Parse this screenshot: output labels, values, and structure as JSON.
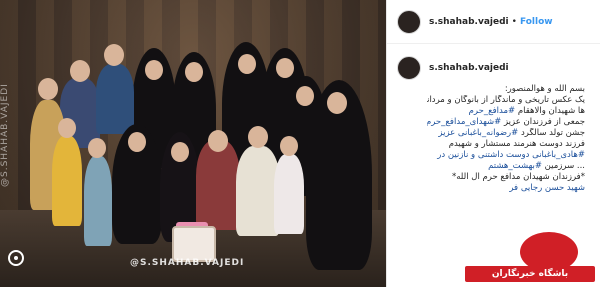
{
  "photo": {
    "side_watermark": "@S.SHAHAB.VAJEDI",
    "bottom_watermark": "@S.SHAHAB.VAJEDI"
  },
  "post": {
    "username": "s.shahab.vajedi",
    "dot": "•",
    "follow_label": "Follow",
    "comment_username": "s.shahab.vajedi",
    "caption_lines": [
      {
        "text": "بسم الله و هوالمنصور:",
        "hashtag": ""
      },
      {
        "text": "یک عکس تاریخی و ماندگار از بانوگان و مردانه",
        "hashtag": ""
      },
      {
        "text": "ها شهیدان والاهقام ",
        "hashtag": "#مدافع_حرم"
      },
      {
        "text": "جمعی از فرزندان عزیز ",
        "hashtag": "#شهدای_مدافع_حرم در"
      },
      {
        "text": "جشن تولد سالگرد ",
        "hashtag": "#رضوانه_باغبانی عزیز"
      },
      {
        "text": "فرزند دوست هنرمند مستشار و شهیدم",
        "hashtag": ""
      },
      {
        "text": "",
        "hashtag": "#هادی_باغبانی دوست داشتنی و نازنین در"
      },
      {
        "text": "... سرزمین ",
        "hashtag": "#بهشت_هشتم"
      },
      {
        "text": "*فرزندان شهیدان مدافع حرم آل الله*",
        "hashtag": ""
      },
      {
        "text": "",
        "hashtag": "شهید حسن رجایی فر"
      }
    ]
  },
  "logo": {
    "label": "باشگاه خبرنگاران"
  },
  "colors": {
    "accent_link": "#3897f0",
    "brand_red": "#d01f26"
  }
}
